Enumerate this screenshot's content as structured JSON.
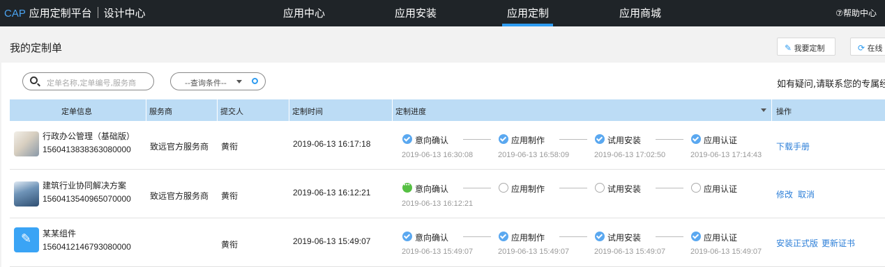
{
  "header": {
    "brand_cap": "CAP",
    "brand_platform": "应用定制平台",
    "brand_center": "设计中心",
    "nav": [
      "应用中心",
      "应用安装",
      "应用定制",
      "应用商城"
    ],
    "active_nav": "应用定制",
    "help": "⑦帮助中心"
  },
  "page": {
    "title": "我的定制单",
    "btn_custom": "我要定制",
    "btn_online": "在线"
  },
  "filters": {
    "search_placeholder": "定单名称,定单编号,服务商",
    "query_label": "--查询条件--",
    "notice": "如有疑问,请联系您的专属经"
  },
  "table": {
    "columns": [
      "定单信息",
      "服务商",
      "提交人",
      "定制时间",
      "定制进度",
      "操作"
    ],
    "rows": [
      {
        "name": "行政办公管理（基础版）",
        "code": "1560413838363080000",
        "provider": "致远官方服务商",
        "submitter": "黄衔",
        "time": "2019-06-13 16:17:18",
        "steps": [
          {
            "label": "意向确认",
            "state": "done",
            "time": "2019-06-13 16:30:08"
          },
          {
            "label": "应用制作",
            "state": "done",
            "time": "2019-06-13 16:58:09"
          },
          {
            "label": "试用安装",
            "state": "done",
            "time": "2019-06-13 17:02:50"
          },
          {
            "label": "应用认证",
            "state": "done",
            "time": "2019-06-13 17:14:43"
          }
        ],
        "actions": [
          "下载手册"
        ]
      },
      {
        "name": "建筑行业协同解决方案",
        "code": "1560413540965070000",
        "provider": "致远官方服务商",
        "submitter": "黄衔",
        "time": "2019-06-13 16:12:21",
        "steps": [
          {
            "label": "意向确认",
            "state": "current",
            "time": "2019-06-13 16:12:21"
          },
          {
            "label": "应用制作",
            "state": "todo",
            "time": ""
          },
          {
            "label": "试用安装",
            "state": "todo",
            "time": ""
          },
          {
            "label": "应用认证",
            "state": "todo",
            "time": ""
          }
        ],
        "actions": [
          "修改",
          "取消"
        ]
      },
      {
        "name": "某某组件",
        "code": "1560412146793080000",
        "provider": "",
        "submitter": "黄衔",
        "time": "2019-06-13 15:49:07",
        "steps": [
          {
            "label": "意向确认",
            "state": "done",
            "time": "2019-06-13 15:49:07"
          },
          {
            "label": "应用制作",
            "state": "done",
            "time": "2019-06-13 15:49:07"
          },
          {
            "label": "试用安装",
            "state": "done",
            "time": "2019-06-13 15:49:07"
          },
          {
            "label": "应用认证",
            "state": "done",
            "time": "2019-06-13 15:49:07"
          }
        ],
        "actions": [
          "安装正式版",
          "更新证书"
        ]
      }
    ]
  },
  "colors": {
    "topbar": "#1f2428",
    "accent": "#2d9bf0",
    "header_row": "#bcdcf5",
    "step_done": "#5aa8f0",
    "step_current": "#56c043",
    "link": "#2d7fd8"
  }
}
